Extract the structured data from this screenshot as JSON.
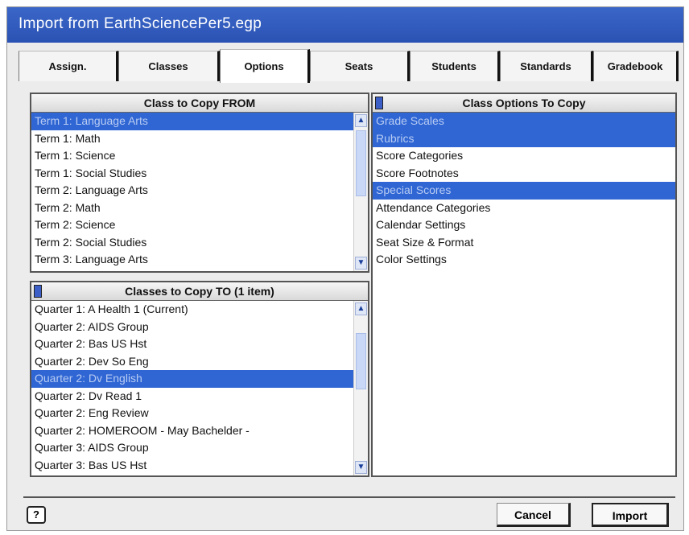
{
  "window": {
    "title": "Import from EarthSciencePer5.egp"
  },
  "tabs": [
    {
      "label": "Assign."
    },
    {
      "label": "Classes"
    },
    {
      "label": "Options"
    },
    {
      "label": "Seats"
    },
    {
      "label": "Students"
    },
    {
      "label": "Standards"
    },
    {
      "label": "Gradebook"
    }
  ],
  "active_tab": "Options",
  "copy_from": {
    "header": "Class to Copy FROM",
    "items": [
      {
        "label": "Term 1: Language Arts",
        "selected": true
      },
      {
        "label": "Term 1: Math"
      },
      {
        "label": "Term 1: Science"
      },
      {
        "label": "Term 1: Social Studies"
      },
      {
        "label": "Term 2: Language Arts"
      },
      {
        "label": "Term 2: Math"
      },
      {
        "label": "Term 2: Science"
      },
      {
        "label": "Term 2: Social Studies"
      },
      {
        "label": "Term 3: Language Arts"
      }
    ]
  },
  "copy_to": {
    "header": "Classes to Copy TO  (1 item)",
    "items": [
      {
        "label": "Quarter 1: A Health 1 (Current)"
      },
      {
        "label": "Quarter 2: AIDS Group"
      },
      {
        "label": "Quarter 2: Bas US Hst"
      },
      {
        "label": "Quarter 2: Dev So Eng"
      },
      {
        "label": "Quarter 2: Dv English",
        "selected": true
      },
      {
        "label": "Quarter 2: Dv Read 1"
      },
      {
        "label": "Quarter 2: Eng Review"
      },
      {
        "label": "Quarter 2: HOMEROOM - May Bachelder -"
      },
      {
        "label": "Quarter 3: AIDS Group"
      },
      {
        "label": "Quarter 3: Bas US Hst"
      }
    ]
  },
  "options": {
    "header": "Class Options To Copy",
    "items": [
      {
        "label": "Grade Scales",
        "selected": true
      },
      {
        "label": "Rubrics",
        "selected": true
      },
      {
        "label": "Score Categories"
      },
      {
        "label": "Score Footnotes"
      },
      {
        "label": "Special Scores",
        "selected": true
      },
      {
        "label": "Attendance Categories"
      },
      {
        "label": "Calendar Settings"
      },
      {
        "label": "Seat Size & Format"
      },
      {
        "label": "Color Settings"
      }
    ]
  },
  "footer": {
    "help_label": "?",
    "cancel_label": "Cancel",
    "import_label": "Import"
  }
}
